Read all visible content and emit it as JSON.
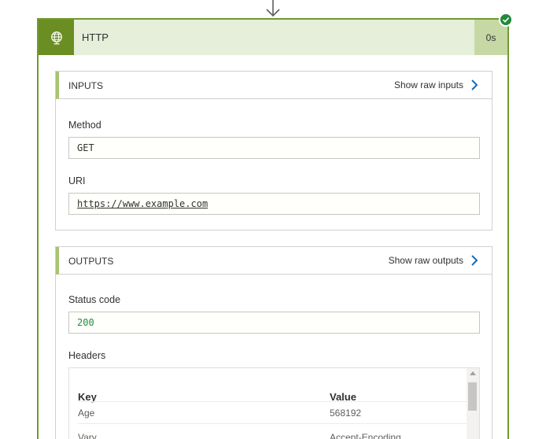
{
  "action": {
    "title": "HTTP",
    "duration": "0s",
    "status": "succeeded",
    "accent_color": "#6b8e23",
    "header_bg": "#e6efd9",
    "success_color": "#218a3c",
    "icon": "globe-icon"
  },
  "inputs": {
    "title": "INPUTS",
    "raw_link": "Show raw inputs",
    "method_label": "Method",
    "method_value": "GET",
    "uri_label": "URI",
    "uri_value": "https://www.example.com"
  },
  "outputs": {
    "title": "OUTPUTS",
    "raw_link": "Show raw outputs",
    "status_label": "Status code",
    "status_value": "200",
    "headers_label": "Headers",
    "headers_columns": [
      "Key",
      "Value"
    ],
    "headers_rows": [
      {
        "key": "Age",
        "value": "568192"
      },
      {
        "key": "Vary",
        "value": "Accept-Encoding"
      }
    ]
  }
}
